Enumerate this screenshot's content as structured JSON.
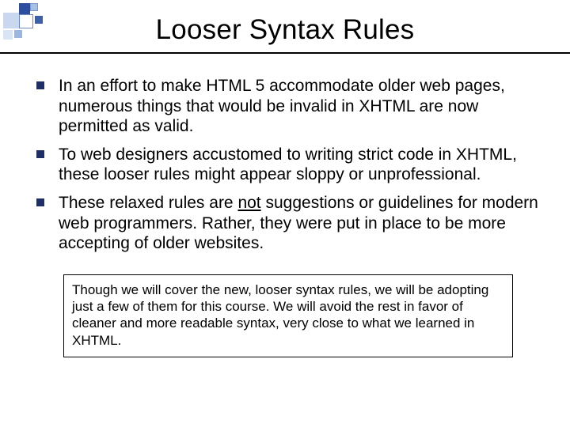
{
  "title": "Looser Syntax Rules",
  "bullets": [
    {
      "text_a": "In an effort to make HTML 5 accommodate older web pages, numerous things that would be invalid in XHTML are now permitted as valid."
    },
    {
      "text_a": "To web designers accustomed to writing strict code in XHTML, these looser rules might appear sloppy or unprofessional."
    },
    {
      "text_a": "These relaxed rules are ",
      "underlined": "not",
      "text_b": " suggestions or guidelines for modern web programmers.  Rather, they were put in place to be more accepting of older websites."
    }
  ],
  "note": "Though we will cover the new, looser syntax rules, we will be adopting just a few of them for this course.  We will avoid the rest in favor of cleaner and more readable syntax, very close to what we learned in XHTML."
}
